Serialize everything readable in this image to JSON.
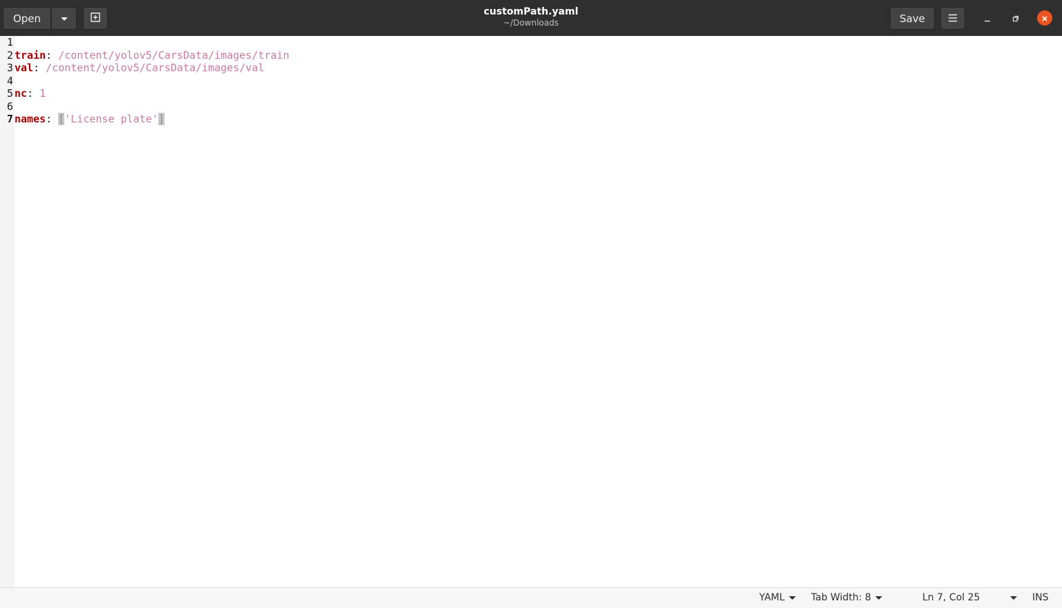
{
  "header": {
    "open_label": "Open",
    "save_label": "Save",
    "title": "customPath.yaml",
    "subtitle": "~/Downloads"
  },
  "editor": {
    "line_numbers": [
      "1",
      "2",
      "3",
      "4",
      "5",
      "6",
      "7"
    ],
    "lines": [
      {
        "key": "",
        "colon": "",
        "value": ""
      },
      {
        "key": "train",
        "colon": ": ",
        "value": "/content/yolov5/CarsData/images/train"
      },
      {
        "key": "val",
        "colon": ": ",
        "value": "/content/yolov5/CarsData/images/val"
      },
      {
        "key": "",
        "colon": "",
        "value": ""
      },
      {
        "key": "nc",
        "colon": ": ",
        "value": "1"
      },
      {
        "key": "",
        "colon": "",
        "value": ""
      },
      {
        "key": "names",
        "colon": ": ",
        "open_bracket": "[",
        "value": "'License plate'",
        "close_bracket": "]"
      }
    ]
  },
  "statusbar": {
    "language": "YAML",
    "tab_width": "Tab Width: 8",
    "cursor": "Ln 7, Col 25",
    "mode": "INS"
  },
  "colors": {
    "headerbar": "#2f2f2f",
    "key": "#a40000",
    "value": "#c97aa0",
    "close_button": "#e95420"
  },
  "icons": {
    "open_menu": "chevron-down-icon",
    "new_document": "new-document-icon",
    "menu": "hamburger-icon",
    "minimize": "minimize-icon",
    "maximize": "maximize-icon",
    "close": "close-icon"
  }
}
